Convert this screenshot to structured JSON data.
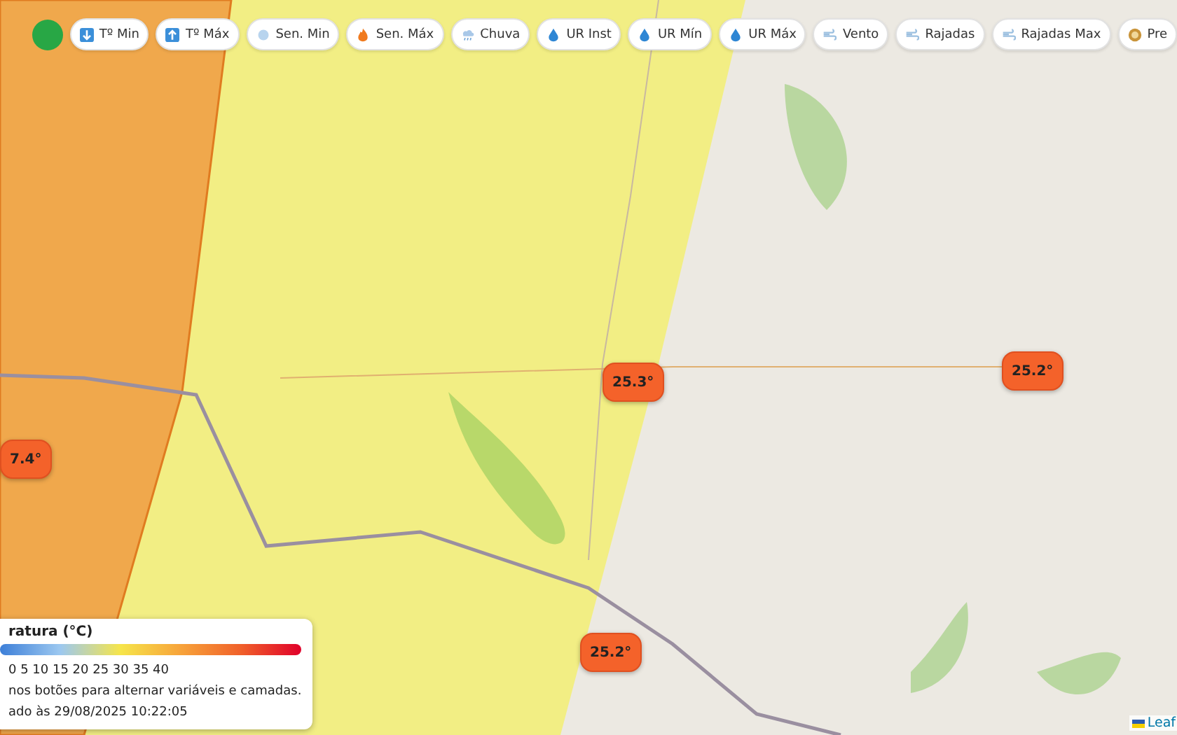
{
  "toolbar": {
    "buttons": [
      {
        "label": "Tº Min",
        "kind": "temp-min"
      },
      {
        "label": "Tº Máx",
        "kind": "temp-max"
      },
      {
        "label": "Sen. Min",
        "kind": "feel-min"
      },
      {
        "label": "Sen. Máx",
        "kind": "feel-max"
      },
      {
        "label": "Chuva",
        "kind": "rain"
      },
      {
        "label": "UR Inst",
        "kind": "humidity"
      },
      {
        "label": "UR Mín",
        "kind": "humidity"
      },
      {
        "label": "UR Máx",
        "kind": "humidity"
      },
      {
        "label": "Vento",
        "kind": "wind"
      },
      {
        "label": "Rajadas",
        "kind": "wind"
      },
      {
        "label": "Rajadas Max",
        "kind": "wind"
      },
      {
        "label": "Pre",
        "kind": "pressure"
      }
    ]
  },
  "markers": [
    {
      "value": "25.3°"
    },
    {
      "value": "25.2°"
    },
    {
      "value": "7.4°"
    },
    {
      "value": "25.2°"
    }
  ],
  "legend": {
    "title": "ratura (°C)",
    "scale": "0 5 10 15 20 25 30 35 40",
    "hint": "nos botões para alternar variáveis e camadas.",
    "updated": "ado às 29/08/2025 10:22:05"
  },
  "attribution": "Leaf"
}
